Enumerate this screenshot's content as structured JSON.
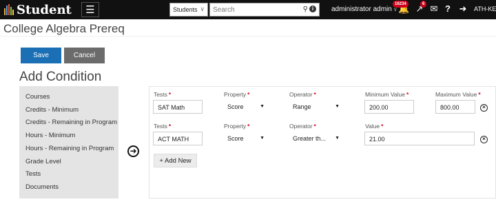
{
  "topbar": {
    "brand": "Student",
    "brand_bar_colors": [
      "#e8a93a",
      "#5aa2d6",
      "#e2564a",
      "#8bc34a",
      "#f3d14b"
    ],
    "menu_icon": "hamburger-icon",
    "scope_select": "Students",
    "search_placeholder": "Search",
    "user_name": "administrator admin",
    "notifications_count": "16234",
    "tasks_count": "6",
    "institution": "ATH-KEN"
  },
  "page": {
    "title": "College Algebra Prereq",
    "save_label": "Save",
    "cancel_label": "Cancel",
    "section_title": "Add Condition"
  },
  "condition_types": [
    "Courses",
    "Credits - Minimum",
    "Credits - Remaining in Program",
    "Hours - Minimum",
    "Hours - Remaining in Program",
    "Grade Level",
    "Tests",
    "Documents"
  ],
  "conditions": [
    {
      "test_label": "Tests",
      "test_value": "SAT Math",
      "property_label": "Property",
      "property_value": "Score",
      "operator_label": "Operator",
      "operator_value": "Range",
      "min_label": "Minimum Value",
      "min_value": "200.00",
      "max_label": "Maximum Value",
      "max_value": "800.00"
    },
    {
      "test_label": "Tests",
      "test_value": "ACT MATH",
      "property_label": "Property",
      "property_value": "Score",
      "operator_label": "Operator",
      "operator_value": "Greater th...",
      "value_label": "Value",
      "value_value": "21.00"
    }
  ],
  "required_marker": "*",
  "add_new_label": "+ Add New",
  "colors": {
    "topbar_bg": "#111111",
    "save": "#1a6fb5",
    "cancel": "#6b6b6b",
    "required": "#d0021b",
    "badge": "#d0021b"
  }
}
